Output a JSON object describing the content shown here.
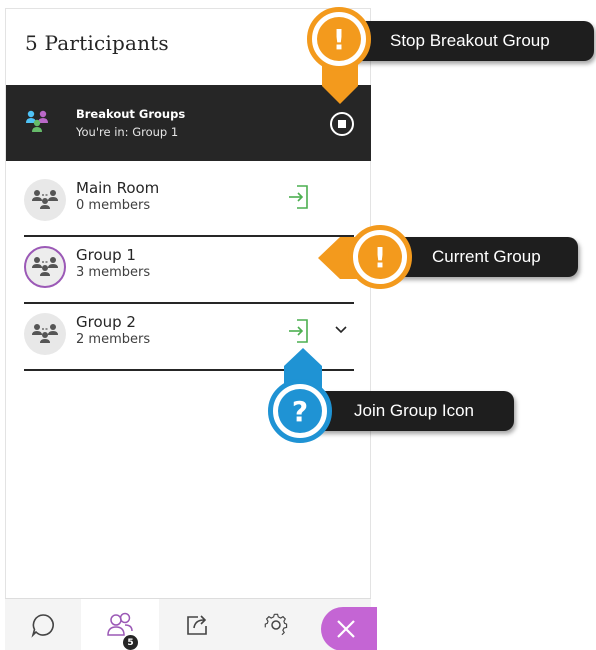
{
  "panel": {
    "title": "5 Participants"
  },
  "breakout": {
    "title": "Breakout Groups",
    "subtitle": "You're in: Group 1",
    "icon": "breakout-groups-icon",
    "stop_icon": "stop-icon"
  },
  "groups": [
    {
      "name": "Main Room",
      "members": "0 members",
      "current": false,
      "join_icon": true,
      "expand": false
    },
    {
      "name": "Group 1",
      "members": "3 members",
      "current": true,
      "join_icon": false,
      "expand": false
    },
    {
      "name": "Group 2",
      "members": "2 members",
      "current": false,
      "join_icon": true,
      "expand": true
    }
  ],
  "nav": {
    "items": [
      "chat-icon",
      "participants-icon",
      "share-content-icon",
      "settings-icon",
      "close-icon"
    ],
    "participants_badge": "5"
  },
  "callouts": {
    "stop": {
      "label": "Stop Breakout Group",
      "glyph": "!"
    },
    "current": {
      "label": "Current Group",
      "glyph": "!"
    },
    "join": {
      "label": "Join Group Icon",
      "glyph": "?"
    }
  },
  "colors": {
    "breakout_bar": "#262626",
    "current_ring": "#9b59b6",
    "join_icon": "#4caf50",
    "callout_orange": "#f39a1d",
    "callout_blue": "#1f93d4",
    "close_button": "#c465d4"
  }
}
